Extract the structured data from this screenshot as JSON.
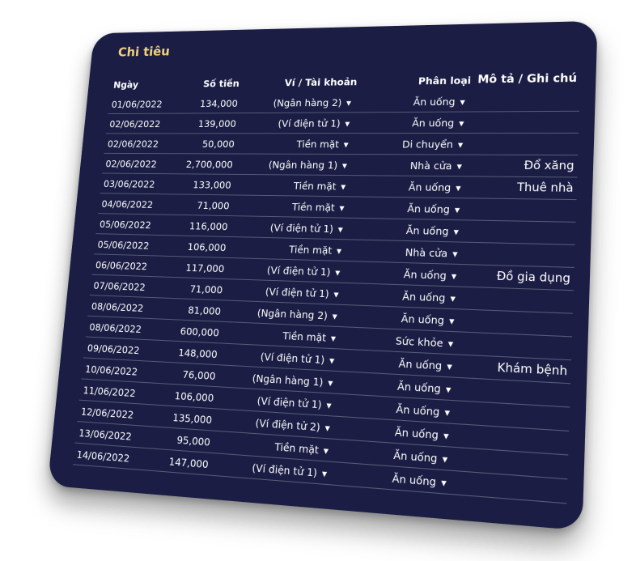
{
  "title": "Chi tiêu",
  "columns": {
    "date": "Ngày",
    "amount": "Số tiền",
    "wallet": "Ví / Tài khoản",
    "category": "Phân loại",
    "note": "Mô tả / Ghi chú"
  },
  "caret": "▼",
  "rows": [
    {
      "date": "01/06/2022",
      "amount": "134,000",
      "wallet": "(Ngân hàng 2)",
      "category": "Ăn uống",
      "note": ""
    },
    {
      "date": "02/06/2022",
      "amount": "139,000",
      "wallet": "(Ví điện tử 1)",
      "category": "Ăn uống",
      "note": ""
    },
    {
      "date": "02/06/2022",
      "amount": "50,000",
      "wallet": "Tiền mặt",
      "category": "Di chuyển",
      "note": ""
    },
    {
      "date": "02/06/2022",
      "amount": "2,700,000",
      "wallet": "(Ngân hàng 1)",
      "category": "Nhà cửa",
      "note": "Đổ xăng"
    },
    {
      "date": "03/06/2022",
      "amount": "133,000",
      "wallet": "Tiền mặt",
      "category": "Ăn uống",
      "note": "Thuê nhà"
    },
    {
      "date": "04/06/2022",
      "amount": "71,000",
      "wallet": "Tiền mặt",
      "category": "Ăn uống",
      "note": ""
    },
    {
      "date": "05/06/2022",
      "amount": "116,000",
      "wallet": "(Ví điện tử 1)",
      "category": "Ăn uống",
      "note": ""
    },
    {
      "date": "05/06/2022",
      "amount": "106,000",
      "wallet": "Tiền mặt",
      "category": "Nhà cửa",
      "note": ""
    },
    {
      "date": "06/06/2022",
      "amount": "117,000",
      "wallet": "(Ví điện tử 1)",
      "category": "Ăn uống",
      "note": "Đồ gia dụng"
    },
    {
      "date": "07/06/2022",
      "amount": "71,000",
      "wallet": "(Ví điện tử 1)",
      "category": "Ăn uống",
      "note": ""
    },
    {
      "date": "08/06/2022",
      "amount": "81,000",
      "wallet": "(Ngân hàng 2)",
      "category": "Ăn uống",
      "note": ""
    },
    {
      "date": "08/06/2022",
      "amount": "600,000",
      "wallet": "Tiền mặt",
      "category": "Sức khỏe",
      "note": ""
    },
    {
      "date": "09/06/2022",
      "amount": "148,000",
      "wallet": "(Ví điện tử 1)",
      "category": "Ăn uống",
      "note": "Khám bệnh"
    },
    {
      "date": "10/06/2022",
      "amount": "76,000",
      "wallet": "(Ngân hàng 1)",
      "category": "Ăn uống",
      "note": ""
    },
    {
      "date": "11/06/2022",
      "amount": "106,000",
      "wallet": "(Ví điện tử 1)",
      "category": "Ăn uống",
      "note": ""
    },
    {
      "date": "12/06/2022",
      "amount": "135,000",
      "wallet": "(Ví điện tử 2)",
      "category": "Ăn uống",
      "note": ""
    },
    {
      "date": "13/06/2022",
      "amount": "95,000",
      "wallet": "Tiền mặt",
      "category": "Ăn uống",
      "note": ""
    },
    {
      "date": "14/06/2022",
      "amount": "147,000",
      "wallet": "(Ví điện tử 1)",
      "category": "Ăn uống",
      "note": ""
    }
  ]
}
